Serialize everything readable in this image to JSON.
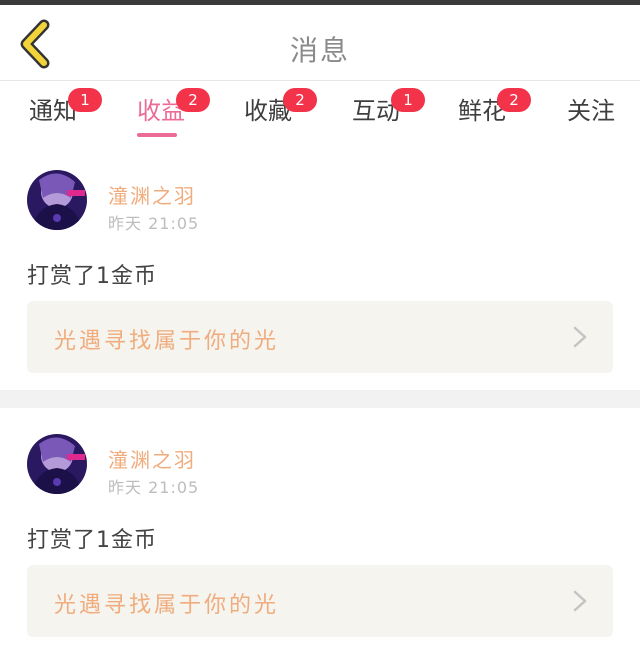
{
  "header": {
    "title": "消息",
    "back_icon": "chevron-left-icon",
    "accent": "#f2d43a"
  },
  "tabs": [
    {
      "label": "通知",
      "badge": "1"
    },
    {
      "label": "收益",
      "badge": "2",
      "active": true
    },
    {
      "label": "收藏",
      "badge": "2"
    },
    {
      "label": "互动",
      "badge": "1"
    },
    {
      "label": "鲜花",
      "badge": "2"
    },
    {
      "label": "关注",
      "badge": ""
    }
  ],
  "messages": [
    {
      "username": "潼渊之羽",
      "time": "昨天 21:05",
      "text": "打赏了1金币",
      "link_text": "光遇寻找属于你的光"
    },
    {
      "username": "潼渊之羽",
      "time": "昨天 21:05",
      "text": "打赏了1金币",
      "link_text": "光遇寻找属于你的光"
    }
  ],
  "colors": {
    "active_tab": "#ec6b96",
    "badge": "#f2334a",
    "username": "#f0ac7d",
    "link_text": "#f0ac7d"
  }
}
